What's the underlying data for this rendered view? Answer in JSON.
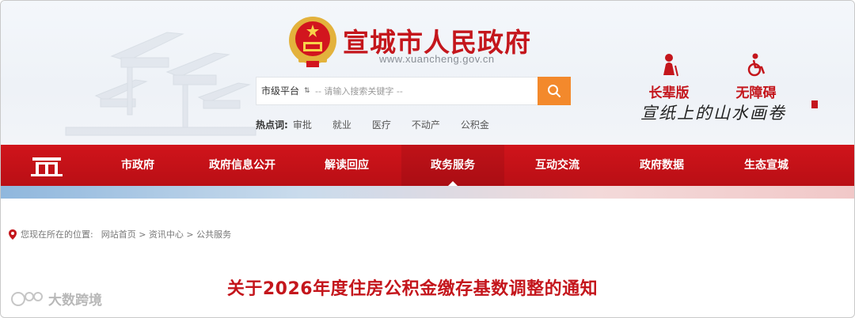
{
  "header": {
    "site_title": "宣城市人民政府",
    "site_url": "www.xuancheng.gov.cn",
    "search": {
      "scope": "市级平台",
      "placeholder": "-- 请输入搜索关键字 --"
    },
    "hot_label": "热点词:",
    "hot_words": [
      "审批",
      "就业",
      "医疗",
      "不动产",
      "公积金"
    ],
    "tools": {
      "elder_label": "长辈版",
      "access_label": "无障碍"
    },
    "slogan": "宣纸上的山水画卷"
  },
  "nav": {
    "items": [
      "市政府",
      "政府信息公开",
      "解读回应",
      "政务服务",
      "互动交流",
      "政府数据",
      "生态宣城"
    ],
    "active": "政务服务"
  },
  "breadcrumb": {
    "prefix": "您现在所在的位置:",
    "path": "网站首页 > 资讯中心 > 公共服务"
  },
  "article": {
    "title": "关于2026年度住房公积金缴存基数调整的通知"
  },
  "watermark": {
    "text": "大数跨境"
  },
  "colors": {
    "brand_red": "#c4161c",
    "search_orange": "#f3892c"
  },
  "icons": [
    "national-emblem-icon",
    "search-icon",
    "elder-person-icon",
    "wheelchair-icon",
    "home-gate-icon",
    "location-pin-icon"
  ]
}
